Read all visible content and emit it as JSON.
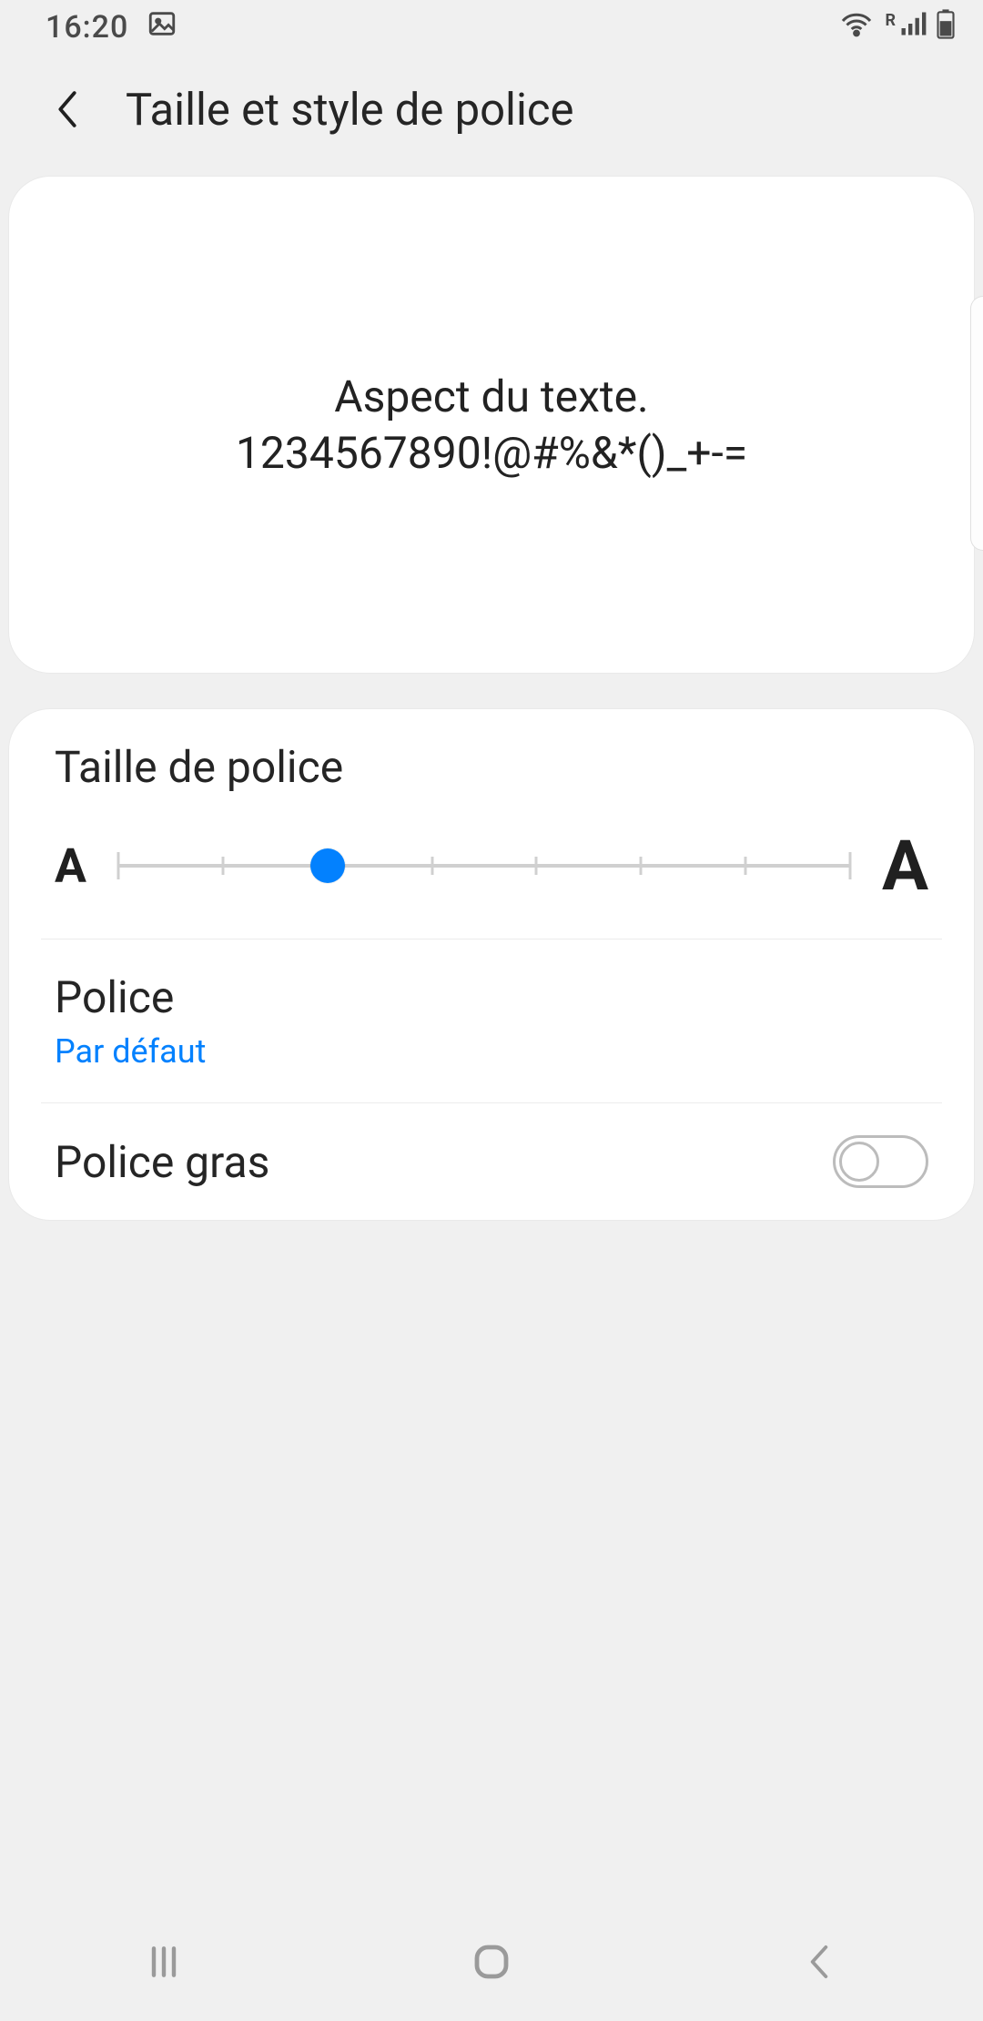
{
  "status": {
    "time": "16:20",
    "icons": {
      "image": "image-icon",
      "wifi": "wifi-icon",
      "roaming": "R",
      "signal": "signal-icon",
      "battery": "battery-icon"
    }
  },
  "header": {
    "title": "Taille et style de police"
  },
  "preview": {
    "line1": "Aspect du texte.",
    "line2": "1234567890!@#%&*()_+-="
  },
  "fontSize": {
    "label": "Taille de police",
    "indicator_small": "A",
    "indicator_large": "A",
    "steps": 8,
    "value_index": 2
  },
  "fontStyle": {
    "label": "Police",
    "value": "Par défaut"
  },
  "boldFont": {
    "label": "Police gras",
    "enabled": false
  },
  "colors": {
    "accent": "#0381fe"
  }
}
